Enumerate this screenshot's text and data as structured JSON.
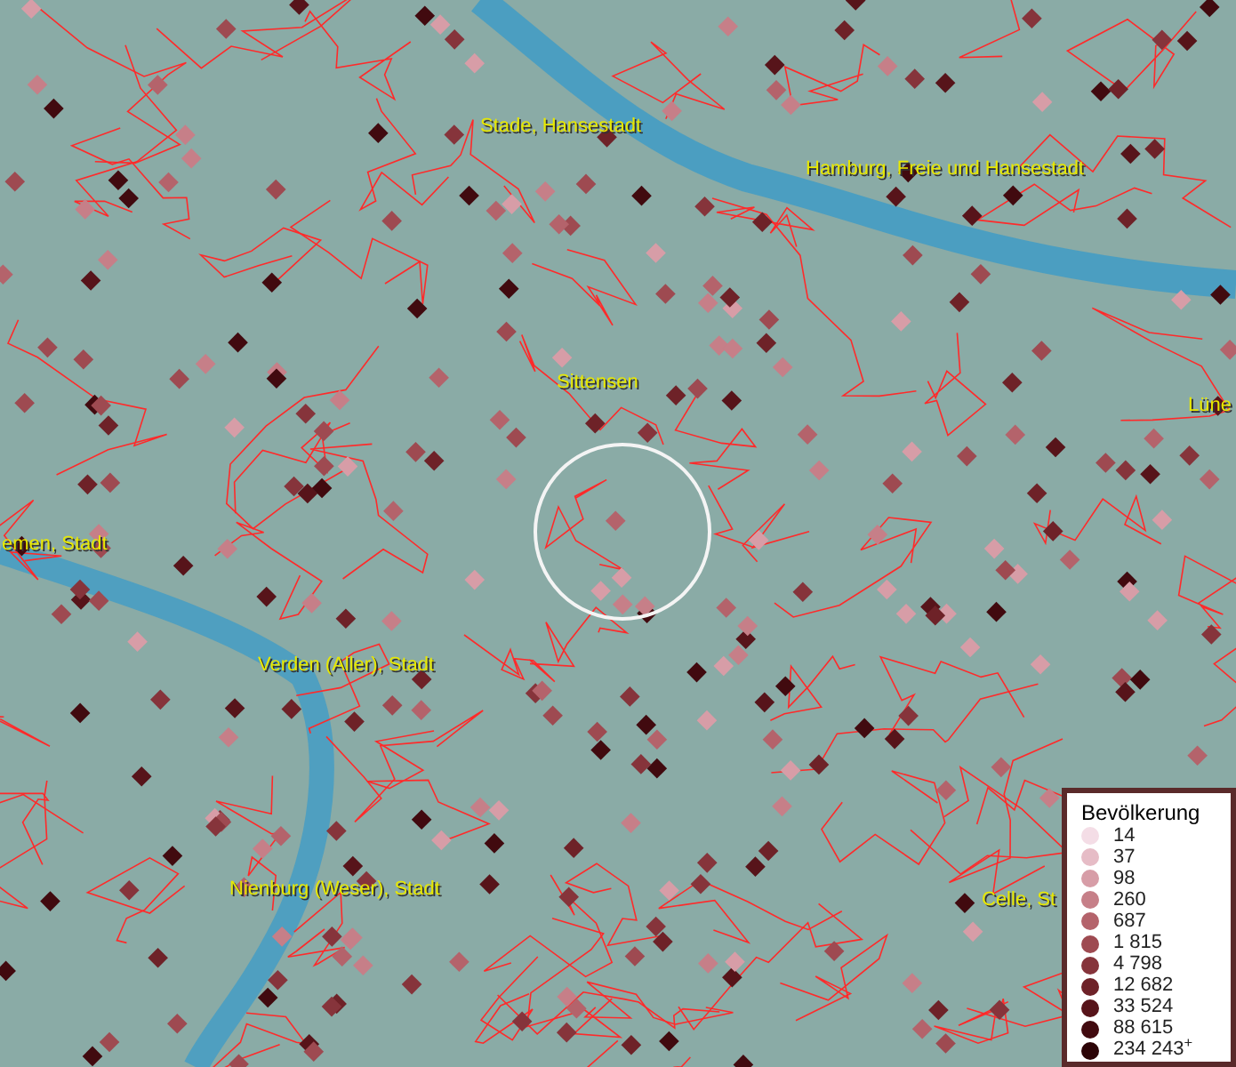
{
  "map": {
    "places": [
      {
        "name": "Stade, Hansestadt"
      },
      {
        "name": "Hamburg, Freie und Hansestadt"
      },
      {
        "name": "Sittensen"
      },
      {
        "name": "Lüne"
      },
      {
        "name": "emen, Stadt"
      },
      {
        "name": "Verden (Aller), Stadt"
      },
      {
        "name": "Nienburg (Weser), Stadt"
      },
      {
        "name": "Celle, St"
      }
    ]
  },
  "legend": {
    "title": "Bevölkerung",
    "items": [
      {
        "label": "14",
        "color": "#f4dde6"
      },
      {
        "label": "37",
        "color": "#e6bcc6"
      },
      {
        "label": "98",
        "color": "#d79da7"
      },
      {
        "label": "260",
        "color": "#c67f88"
      },
      {
        "label": "687",
        "color": "#b4636b"
      },
      {
        "label": "1 815",
        "color": "#9e4a51"
      },
      {
        "label": "4 798",
        "color": "#86343b"
      },
      {
        "label": "12 682",
        "color": "#6e2228"
      },
      {
        "label": "33 524",
        "color": "#57141a"
      },
      {
        "label": "88 615",
        "color": "#410a0f"
      },
      {
        "label": "234 243$^{+}$",
        "color": "#2c0407"
      }
    ]
  }
}
